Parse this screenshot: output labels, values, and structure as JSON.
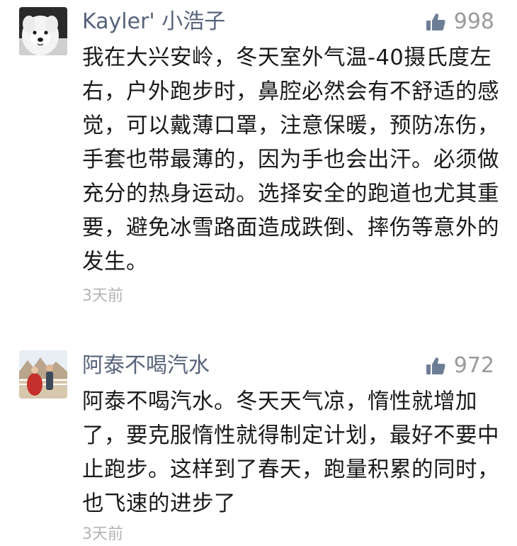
{
  "comments": [
    {
      "username": "Kayler' 小浩子",
      "likes": "998",
      "text": "我在大兴安岭，冬天室外气温-40摄氏度左右，户外跑步时，鼻腔必然会有不舒适的感觉，可以戴薄口罩，注意保暖，预防冻伤，手套也带最薄的，因为手也会出汗。必须做充分的热身运动。选择安全的跑道也尤其重要，避免冰雪路面造成跌倒、摔伤等意外的发生。",
      "time": "3天前",
      "avatar_icon": "white-dog-avatar"
    },
    {
      "username": "阿泰不喝汽水",
      "likes": "972",
      "text": "阿泰不喝汽水。冬天天气凉，惰性就增加了，要克服惰性就得制定计划，最好不要中止跑步。这样到了春天，跑量积累的同时，也飞速的进步了",
      "time": "3天前",
      "avatar_icon": "outdoor-couple-avatar"
    }
  ],
  "icons": {
    "like": "thumbs-up-icon"
  },
  "colors": {
    "username": "#56637a",
    "like_icon": "#6d7d95",
    "like_count": "#9a9a9a",
    "time": "#b4b4b4",
    "text": "#1a1a1a"
  }
}
